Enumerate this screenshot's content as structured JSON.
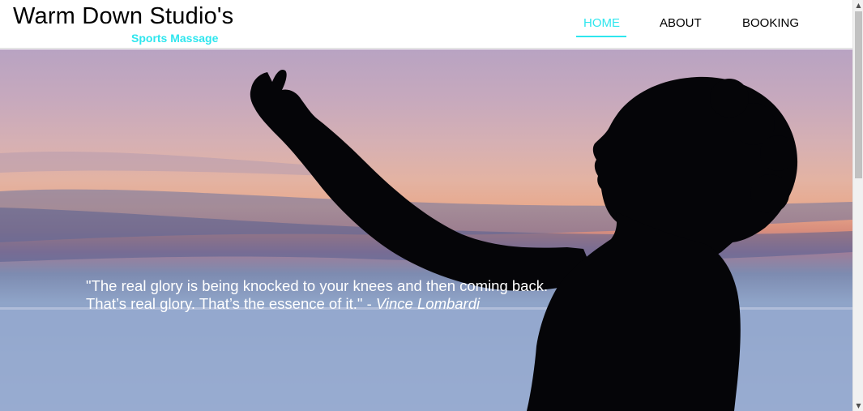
{
  "header": {
    "title": "Warm Down Studio's",
    "subtitle": "Sports Massage"
  },
  "nav": {
    "items": [
      {
        "label": "HOME",
        "active": true
      },
      {
        "label": "ABOUT",
        "active": false
      },
      {
        "label": "BOOKING",
        "active": false
      }
    ]
  },
  "hero": {
    "quote_line1": "\"The real glory is being knocked to your knees and then coming back.",
    "quote_line2": "That’s real glory. That’s the essence of it.\" - ",
    "quote_author": "Vince Lombardi"
  },
  "scrollbar": {
    "up_icon": "triangle-up-icon",
    "down_icon": "triangle-down-icon"
  },
  "colors": {
    "accent": "#2ee6ee",
    "text": "#000000",
    "quote_text": "#ffffff"
  }
}
